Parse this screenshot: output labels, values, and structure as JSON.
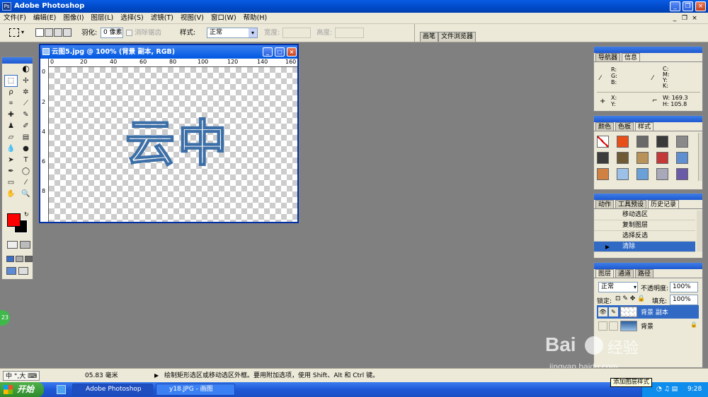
{
  "app": {
    "title": "Adobe Photoshop",
    "icon_letters": "Ps"
  },
  "menu": [
    "文件(F)",
    "编辑(E)",
    "图像(I)",
    "图层(L)",
    "选择(S)",
    "滤镜(T)",
    "视图(V)",
    "窗口(W)",
    "帮助(H)"
  ],
  "options": {
    "feather_label": "羽化:",
    "feather_value": "0 像素",
    "antialias_label": "消除锯齿",
    "style_label": "样式:",
    "style_value": "正常",
    "width_label": "宽度:",
    "height_label": "高度:",
    "tab_brush": "画笔",
    "tab_browser": "文件浏览器"
  },
  "document": {
    "title": "云图5.jpg @ 100% (背景 副本, RGB)",
    "ruler_h": [
      "0",
      "20",
      "40",
      "60",
      "80",
      "100",
      "120",
      "140",
      "160"
    ],
    "ruler_v": [
      "0",
      "2",
      "4",
      "6",
      "8"
    ],
    "selection_text": "云中"
  },
  "navigator": {
    "tab_navigator": "导航器",
    "tab_info": "信息",
    "rgb": [
      "R:",
      "G:",
      "B:"
    ],
    "cmyk": [
      "C:",
      "M:",
      "Y:",
      "K:"
    ],
    "xy": [
      "X:",
      "Y:"
    ],
    "w_label": "W:",
    "w_value": "169.3",
    "h_label": "H:",
    "h_value": "105.8"
  },
  "styles_panel": {
    "tabs": [
      "颜色",
      "色板",
      "样式"
    ],
    "swatches": [
      "#ffffff",
      "#e8501a",
      "#6a6a6a",
      "#3a3a3a",
      "#8a8a8a",
      "#3c3c3c",
      "#6e5a34",
      "#b9925a",
      "#c43838",
      "#5f8fd0",
      "#d08040",
      "#9cc0e8",
      "#6aa0d8",
      "#a8a8b8",
      "#6a5aa8"
    ]
  },
  "history_panel": {
    "tabs": [
      "动作",
      "工具预设",
      "历史记录"
    ],
    "items": [
      "移动选区",
      "复制图层",
      "选择反选",
      "清除"
    ]
  },
  "layers_panel": {
    "tabs": [
      "图层",
      "通道",
      "路径"
    ],
    "blend_mode": "正常",
    "opacity_label": "不透明度:",
    "opacity_value": "100%",
    "lock_label": "锁定:",
    "fill_label": "填充:",
    "fill_value": "100%",
    "layers": [
      "背景 副本",
      "背景"
    ]
  },
  "tooltip": "添加图层样式",
  "status": {
    "ime": "中",
    "ime_extra": "°,大",
    "zoom": "05.83 毫米",
    "hint": "绘制矩形选区或移动选区外框。要用附加选项，使用 Shift、Alt 和 Ctrl 键。"
  },
  "taskbar": {
    "start": "开始",
    "items": [
      "Adobe Photoshop",
      "y18.JPG - 画图"
    ],
    "time": "9:28"
  },
  "badge": "23",
  "watermark": {
    "logo": "Bai",
    "logo2": "经验",
    "url": "jingyan.baidu.com"
  },
  "colors": {
    "foreground": "#ff0000",
    "background": "#000000",
    "titlebar": "#0a5ce4",
    "selection": "#316ac5"
  }
}
